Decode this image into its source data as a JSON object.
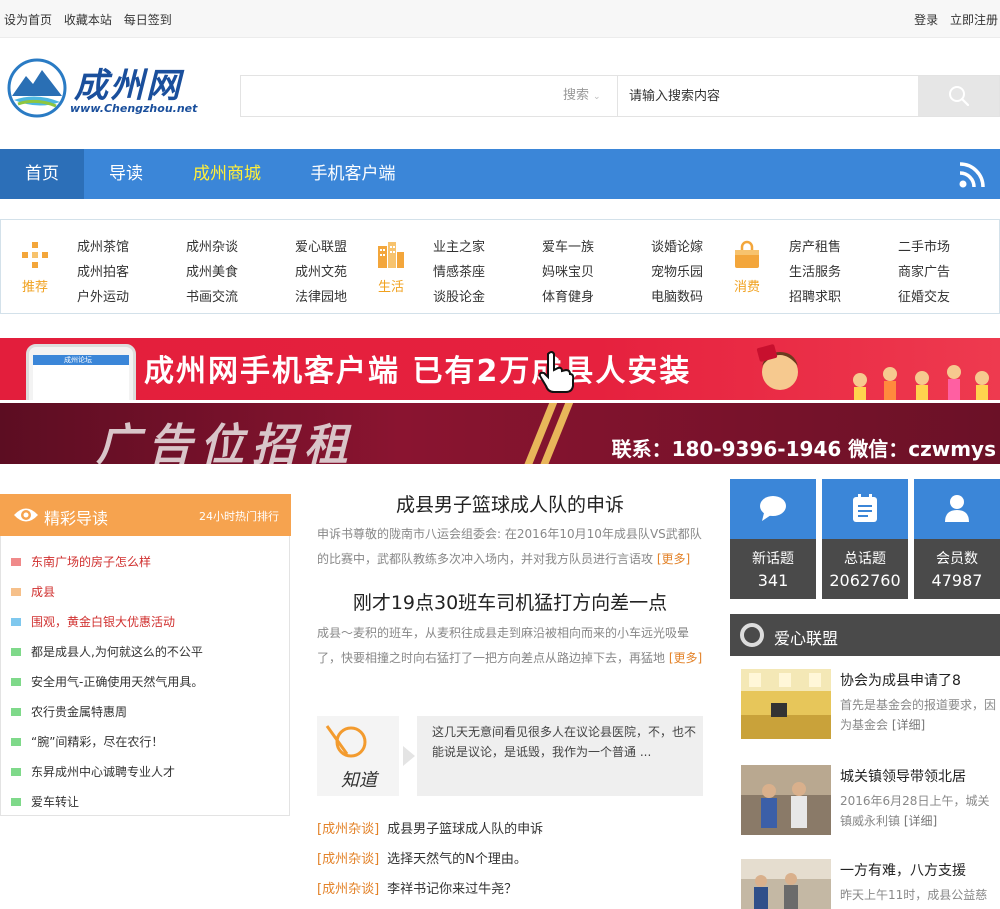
{
  "topbar": {
    "left": [
      "设为首页",
      "收藏本站",
      "每日签到"
    ],
    "right": [
      "登录",
      "立即注册"
    ]
  },
  "logo": {
    "text": "成州网",
    "url": "www.Chengzhou.net"
  },
  "search": {
    "category": "搜索",
    "placeholder": "请输入搜索内容"
  },
  "nav": {
    "items": [
      "首页",
      "导读",
      "成州商城",
      "手机客户端"
    ]
  },
  "categories": {
    "groups": [
      {
        "label": "推荐",
        "links": [
          "成州茶馆",
          "成州杂谈",
          "爱心联盟",
          "成州拍客",
          "成州美食",
          "成州文苑",
          "户外运动",
          "书画交流",
          "法律园地"
        ]
      },
      {
        "label": "生活",
        "links": [
          "业主之家",
          "爱车一族",
          "谈婚论嫁",
          "情感茶座",
          "妈咪宝贝",
          "宠物乐园",
          "谈股论金",
          "体育健身",
          "电脑数码"
        ]
      },
      {
        "label": "消费",
        "links": [
          "房产租售",
          "二手市场",
          "生活服务",
          "商家广告",
          "招聘求职",
          "征婚交友"
        ]
      }
    ]
  },
  "banner1": {
    "text": "成州网手机客户端 已有2万成县人安装",
    "phone_title": "成州论坛"
  },
  "banner2": {
    "text": "广告位招租",
    "contact": "联系：180-9396-1946  微信：czwmys"
  },
  "left_panel": {
    "title": "精彩导读",
    "subtitle": "24小时热门排行",
    "items": [
      {
        "text": "东南广场的房子怎么样",
        "color": "#f08a8a",
        "red": true
      },
      {
        "text": "成县",
        "color": "#f6c08a",
        "red": true
      },
      {
        "text": "围观，黄金白银大优惠活动",
        "color": "#7fc8ee",
        "red": true
      },
      {
        "text": "都是成县人,为何就这么的不公平",
        "color": "#7fd98a",
        "red": false
      },
      {
        "text": "安全用气-正确使用天然气用具。",
        "color": "#7fd98a",
        "red": false
      },
      {
        "text": "农行贵金属特惠周",
        "color": "#7fd98a",
        "red": false
      },
      {
        "text": "“腕”间精彩，尽在农行！",
        "color": "#7fd98a",
        "red": false
      },
      {
        "text": "东昇成州中心诚聘专业人才",
        "color": "#7fd98a",
        "red": false
      },
      {
        "text": "爱车转让",
        "color": "#7fd98a",
        "red": false
      }
    ]
  },
  "middle": {
    "article1": {
      "title": "成县男子篮球成人队的申诉",
      "body": "申诉书尊敬的陇南市八运会组委会: 在2016年10月10年成县队VS武都队的比赛中，武都队教练多次冲入场内，并对我方队员进行言语攻",
      "more": "[更多]"
    },
    "article2": {
      "title": "刚才19点30班车司机猛打方向差一点",
      "body": "成县～麦积的班车，从麦积往成县走到麻沿被相向而来的小车远光吸晕了，快要相撞之时向右猛打了一把方向差点从路边掉下去，再猛地",
      "more": "[更多]"
    },
    "zhidao": {
      "logo": "知道",
      "text": "这几天无意间看见很多人在议论县医院，不，也不能说是议论，是诋毁，我作为一个普通 ..."
    },
    "links": [
      {
        "tag": "[成州杂谈]",
        "text": "成县男子篮球成人队的申诉"
      },
      {
        "tag": "[成州杂谈]",
        "text": "选择天然气的N个理由。"
      },
      {
        "tag": "[成州杂谈]",
        "text": "李祥书记你来过牛尧？"
      }
    ]
  },
  "stats": [
    {
      "label": "新话题",
      "value": "341",
      "icon": "chat-bubble-icon"
    },
    {
      "label": "总话题",
      "value": "2062760",
      "icon": "clipboard-icon"
    },
    {
      "label": "会员数",
      "value": "47987",
      "icon": "user-icon"
    }
  ],
  "right_panel": {
    "title": "爱心联盟",
    "items": [
      {
        "title": "协会为成县申请了8",
        "desc": "首先是基金会的报道要求，因为基金会",
        "detail": "[详细]"
      },
      {
        "title": "城关镇领导带领北居",
        "desc": "2016年6月28日上午，城关镇威永利镇",
        "detail": "[详细]"
      },
      {
        "title": "一方有难，八方支援",
        "desc": "昨天上午11时，成县公益慈",
        "detail": ""
      }
    ]
  },
  "colors": {
    "nav": "#3b86d8",
    "accent_orange": "#f6a34f",
    "link_orange": "#e3832a",
    "banner_red": "#e31e3c"
  }
}
